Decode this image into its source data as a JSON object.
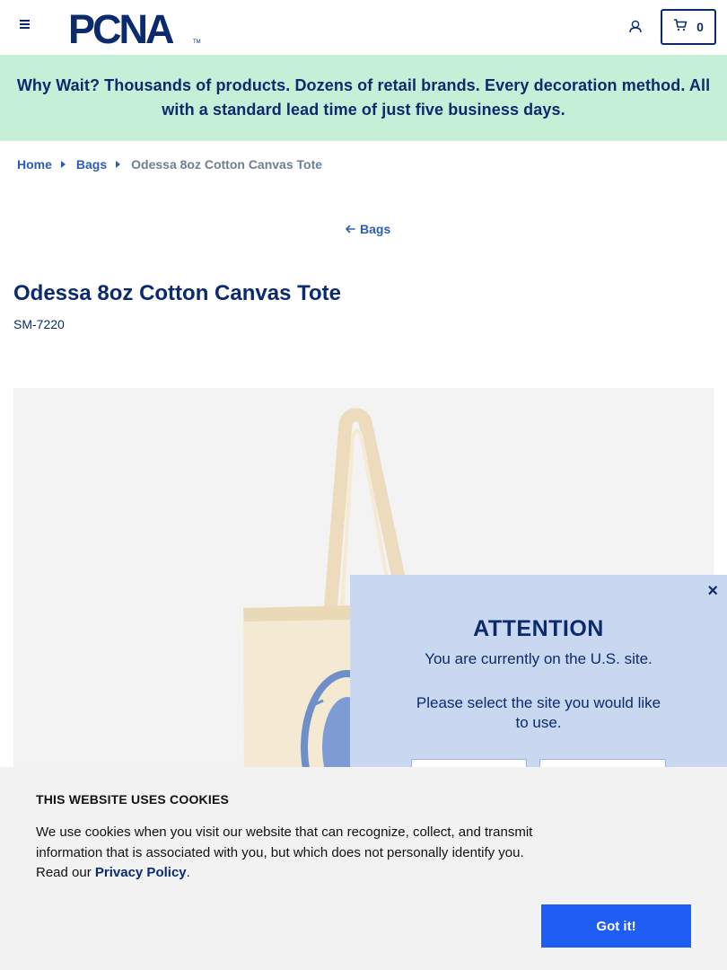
{
  "header": {
    "logo_text": "PCNA",
    "logo_tm": "TM",
    "cart_count": "0"
  },
  "promo": {
    "text": "Why Wait? Thousands of products. Dozens of retail brands. Every decoration method. All with a standard lead time of just five business days."
  },
  "breadcrumb": {
    "items": [
      "Home",
      "Bags"
    ],
    "current": "Odessa 8oz Cotton Canvas Tote"
  },
  "back_link": "Bags",
  "product": {
    "title": "Odessa 8oz Cotton Canvas Tote",
    "sku": "SM-7220"
  },
  "attention": {
    "title": "ATTENTION",
    "message": "You are currently on the U.S. site.",
    "prompt": "Please select the site you would like to use.",
    "close": "×"
  },
  "cookie": {
    "title": "THIS WEBSITE USES COOKIES",
    "text": "We use cookies when you visit our website that can recognize, collect, and transmit information that is associated with you, but which does not personally identify you. Read our",
    "link": "Privacy Policy",
    "button": "Got it!"
  },
  "colors": {
    "brand": "#0b2b6e",
    "link": "#2c5db5",
    "promo_bg": "#c5efd6",
    "modal_bg": "#c9d7f0",
    "cookie_button": "#1f5ef2"
  }
}
